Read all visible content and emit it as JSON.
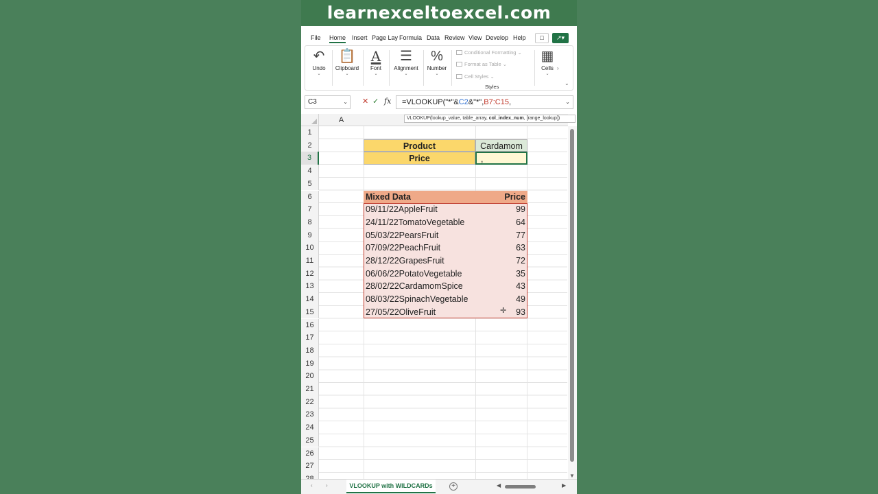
{
  "banner": {
    "title": "learnexceltoexcel.com"
  },
  "menu": {
    "tabs": [
      "File",
      "Home",
      "Insert",
      "Page Lay",
      "Formula",
      "Data",
      "Review",
      "View",
      "Develop",
      "Help"
    ],
    "active": "Home"
  },
  "ribbon": {
    "groups": [
      {
        "label": "Undo",
        "icon": "undo-icon"
      },
      {
        "label": "Clipboard",
        "icon": "clipboard-icon"
      },
      {
        "label": "Font",
        "icon": "font-icon"
      },
      {
        "label": "Alignment",
        "icon": "alignment-icon"
      },
      {
        "label": "Number",
        "icon": "number-icon"
      },
      {
        "label": "Cells",
        "icon": "cells-icon"
      }
    ],
    "styles": {
      "conditional": "Conditional Formatting",
      "format_table": "Format as Table",
      "cell_styles": "Cell Styles",
      "label": "Styles"
    }
  },
  "formula_bar": {
    "name_box": "C3",
    "formula_prefix": "=VLOOKUP(\"*\"&",
    "formula_ref1": "C2",
    "formula_mid": "&\"*\",",
    "formula_ref2": "B7:C15",
    "formula_suffix": ",",
    "tooltip_a": "VLOOKUP(lookup_value, table_array, ",
    "tooltip_b": "col_index_num",
    "tooltip_c": ", [range_lookup])"
  },
  "sheet": {
    "column_a": "A",
    "rows": [
      "1",
      "2",
      "3",
      "4",
      "5",
      "6",
      "7",
      "8",
      "9",
      "10",
      "11",
      "12",
      "13",
      "14",
      "15",
      "16",
      "17",
      "18",
      "19",
      "20",
      "21",
      "22",
      "23",
      "24",
      "25",
      "26",
      "27",
      "28"
    ],
    "product_label": "Product",
    "product_value": "Cardamom",
    "price_label": "Price",
    "price_value": ",",
    "table_header": {
      "mixed": "Mixed Data",
      "price": "Price"
    },
    "table_rows": [
      {
        "mixed": "09/11/22AppleFruit",
        "price": "99"
      },
      {
        "mixed": "24/11/22TomatoVegetable",
        "price": "64"
      },
      {
        "mixed": "05/03/22PearsFruit",
        "price": "77"
      },
      {
        "mixed": "07/09/22PeachFruit",
        "price": "63"
      },
      {
        "mixed": "28/12/22GrapesFruit",
        "price": "72"
      },
      {
        "mixed": "06/06/22PotatoVegetable",
        "price": "35"
      },
      {
        "mixed": "28/02/22CardamomSpice",
        "price": "43"
      },
      {
        "mixed": "08/03/22SpinachVegetable",
        "price": "49"
      },
      {
        "mixed": "27/05/22OliveFruit",
        "price": "93"
      }
    ]
  },
  "sheet_tab": {
    "name": "VLOOKUP with WILDCARDs"
  },
  "colors": {
    "excel_green": "#217346",
    "header_yellow": "#fbd76b",
    "table_orange": "#efa988",
    "table_pink": "#f7e2df"
  }
}
